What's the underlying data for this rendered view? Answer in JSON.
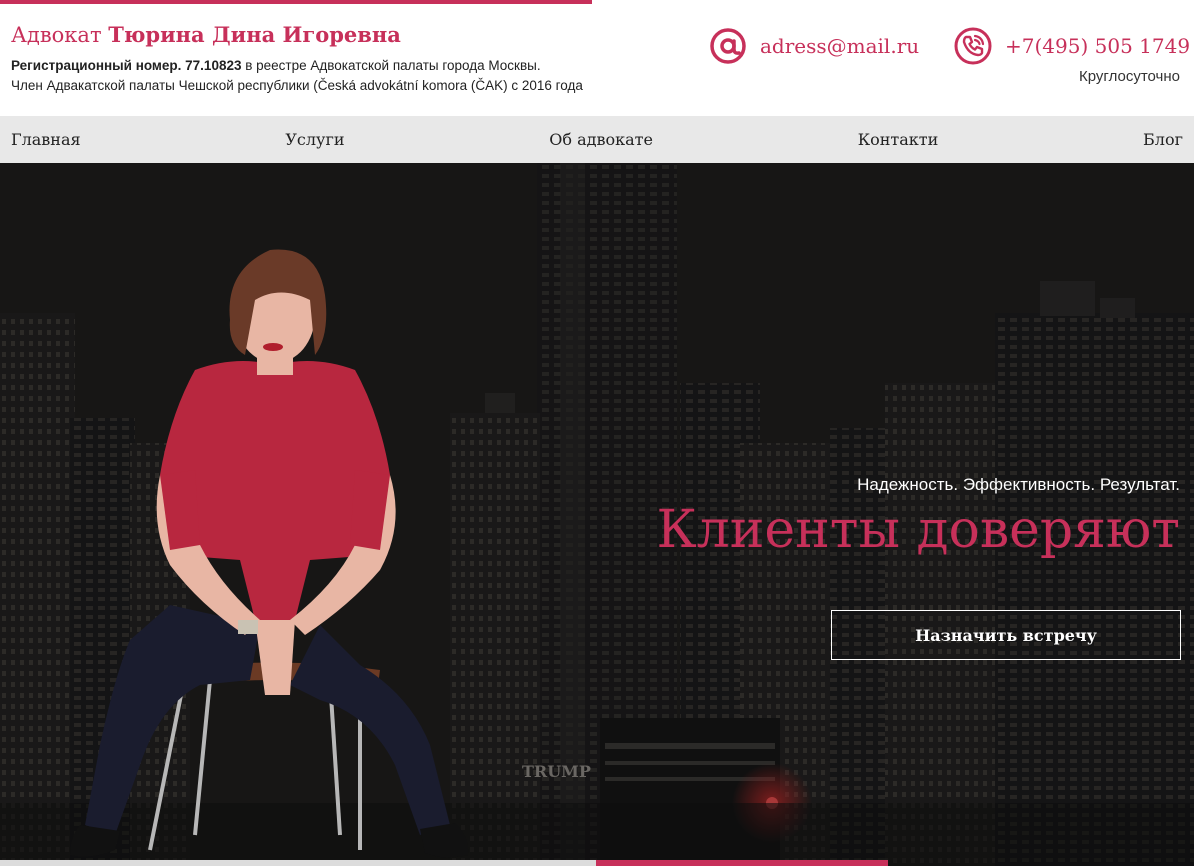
{
  "header": {
    "brand_prefix": "Адвокат ",
    "brand_name": "Тюрина Дина Игоревна",
    "reg_label": "Регистрационный номер. 77.10823",
    "reg_rest": " в реестре Адвокатской палаты города Москвы.",
    "member": "Член Адвакатской палаты Чешской республики (Česká advokátní komora (ČAK) с 2016 года",
    "email": "adress@mail.ru",
    "phone": "+7(495) 505 1749",
    "hours": "Круглосуточно"
  },
  "nav": {
    "items": [
      "Главная",
      "Услуги",
      "Об адвокате",
      "Контакти",
      "Блог"
    ]
  },
  "hero": {
    "tagline": "Надежность. Эффективность. Результат.",
    "headline": "Клиенты доверяют",
    "cta": "Назначить встречу",
    "sign_text": "TRUMP"
  },
  "colors": {
    "accent": "#c7305a",
    "nav_bg": "#e8e8e8",
    "hero_bg": "#1f1e1d",
    "blouse": "#b8273f",
    "pants": "#1a1c2e"
  },
  "icons": {
    "email": "at-icon",
    "phone": "phone-icon"
  }
}
